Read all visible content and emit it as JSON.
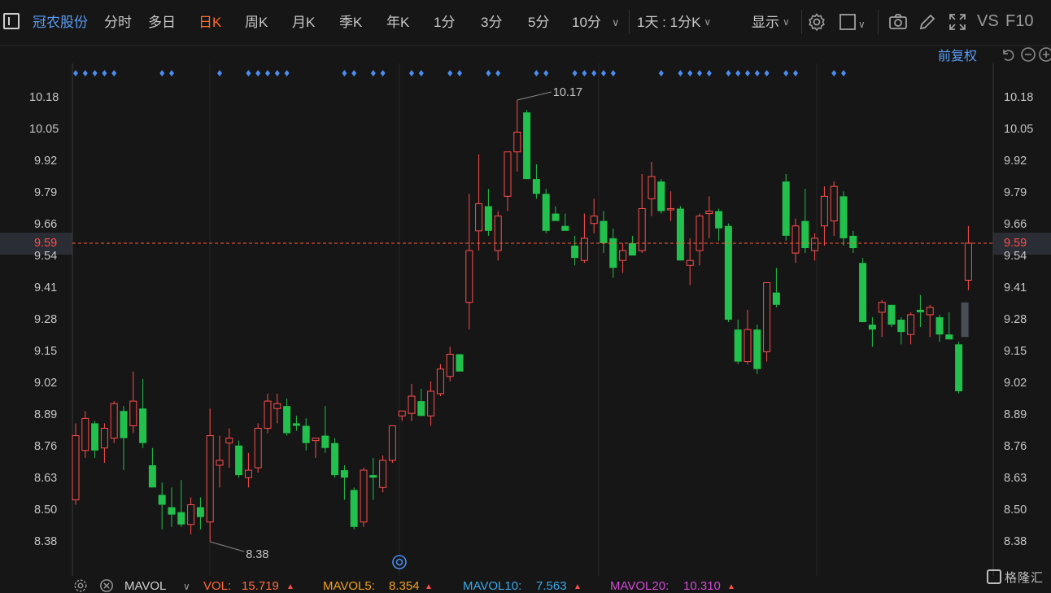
{
  "toolbar": {
    "stock_name": "冠农股份",
    "periods": [
      {
        "label": "分时",
        "active": false
      },
      {
        "label": "多日",
        "active": false
      },
      {
        "label": "日K",
        "active": true
      },
      {
        "label": "周K",
        "active": false
      },
      {
        "label": "月K",
        "active": false
      },
      {
        "label": "季K",
        "active": false
      },
      {
        "label": "年K",
        "active": false
      },
      {
        "label": "1分",
        "active": false
      },
      {
        "label": "3分",
        "active": false
      },
      {
        "label": "5分",
        "active": false
      },
      {
        "label": "10分",
        "active": false
      }
    ],
    "interval_select": "1天 : 1分K",
    "display_label": "显示",
    "vs_label": "VS",
    "f10_label": "F10"
  },
  "chart": {
    "adjust_label": "前复权",
    "y_ticks": [
      "10.18",
      "10.05",
      "9.92",
      "9.79",
      "9.66",
      "9.54",
      "9.41",
      "9.28",
      "9.15",
      "9.02",
      "8.89",
      "8.76",
      "8.63",
      "8.50",
      "8.38"
    ],
    "current_price": "9.59",
    "max_label": "10.17",
    "min_label": "8.38",
    "colors": {
      "up": "#ff4d4d",
      "down": "#22c04c",
      "axis": "#3a3a3a",
      "marker": "#4a8df0"
    }
  },
  "chart_data": {
    "type": "candlestick",
    "ylim": [
      8.32,
      10.24
    ],
    "candles": [
      {
        "o": 8.55,
        "h": 8.86,
        "l": 8.53,
        "c": 8.81
      },
      {
        "o": 8.75,
        "h": 8.91,
        "l": 8.72,
        "c": 8.88
      },
      {
        "o": 8.86,
        "h": 8.87,
        "l": 8.72,
        "c": 8.75
      },
      {
        "o": 8.76,
        "h": 8.86,
        "l": 8.7,
        "c": 8.84
      },
      {
        "o": 8.8,
        "h": 8.95,
        "l": 8.78,
        "c": 8.94
      },
      {
        "o": 8.91,
        "h": 8.93,
        "l": 8.67,
        "c": 8.8
      },
      {
        "o": 8.85,
        "h": 9.07,
        "l": 8.82,
        "c": 8.95
      },
      {
        "o": 8.92,
        "h": 9.04,
        "l": 8.76,
        "c": 8.78
      },
      {
        "o": 8.69,
        "h": 8.76,
        "l": 8.61,
        "c": 8.6
      },
      {
        "o": 8.57,
        "h": 8.62,
        "l": 8.43,
        "c": 8.53
      },
      {
        "o": 8.52,
        "h": 8.6,
        "l": 8.44,
        "c": 8.49
      },
      {
        "o": 8.5,
        "h": 8.63,
        "l": 8.44,
        "c": 8.45
      },
      {
        "o": 8.45,
        "h": 8.56,
        "l": 8.41,
        "c": 8.53
      },
      {
        "o": 8.52,
        "h": 8.56,
        "l": 8.43,
        "c": 8.48
      },
      {
        "o": 8.46,
        "h": 8.92,
        "l": 8.38,
        "c": 8.81
      },
      {
        "o": 8.69,
        "h": 8.81,
        "l": 8.6,
        "c": 8.71
      },
      {
        "o": 8.78,
        "h": 8.84,
        "l": 8.68,
        "c": 8.8
      },
      {
        "o": 8.77,
        "h": 8.79,
        "l": 8.64,
        "c": 8.65
      },
      {
        "o": 8.64,
        "h": 8.74,
        "l": 8.6,
        "c": 8.67
      },
      {
        "o": 8.68,
        "h": 8.86,
        "l": 8.66,
        "c": 8.84
      },
      {
        "o": 8.84,
        "h": 8.98,
        "l": 8.82,
        "c": 8.95
      },
      {
        "o": 8.92,
        "h": 8.98,
        "l": 8.86,
        "c": 8.94
      },
      {
        "o": 8.93,
        "h": 8.96,
        "l": 8.81,
        "c": 8.82
      },
      {
        "o": 8.86,
        "h": 8.89,
        "l": 8.83,
        "c": 8.85
      },
      {
        "o": 8.85,
        "h": 8.88,
        "l": 8.75,
        "c": 8.78
      },
      {
        "o": 8.79,
        "h": 8.8,
        "l": 8.72,
        "c": 8.8
      },
      {
        "o": 8.81,
        "h": 8.93,
        "l": 8.74,
        "c": 8.76
      },
      {
        "o": 8.78,
        "h": 8.8,
        "l": 8.64,
        "c": 8.65
      },
      {
        "o": 8.67,
        "h": 8.69,
        "l": 8.55,
        "c": 8.64
      },
      {
        "o": 8.59,
        "h": 8.6,
        "l": 8.43,
        "c": 8.44
      },
      {
        "o": 8.46,
        "h": 8.68,
        "l": 8.44,
        "c": 8.67
      },
      {
        "o": 8.65,
        "h": 8.72,
        "l": 8.55,
        "c": 8.64
      },
      {
        "o": 8.6,
        "h": 8.73,
        "l": 8.58,
        "c": 8.71
      },
      {
        "o": 8.71,
        "h": 8.85,
        "l": 8.7,
        "c": 8.85
      },
      {
        "o": 8.89,
        "h": 8.91,
        "l": 8.87,
        "c": 8.91
      },
      {
        "o": 8.9,
        "h": 9.02,
        "l": 8.87,
        "c": 8.97
      },
      {
        "o": 8.95,
        "h": 9.0,
        "l": 8.89,
        "c": 8.89
      },
      {
        "o": 8.89,
        "h": 9.03,
        "l": 8.85,
        "c": 8.99
      },
      {
        "o": 8.98,
        "h": 9.1,
        "l": 8.97,
        "c": 9.08
      },
      {
        "o": 9.05,
        "h": 9.17,
        "l": 9.03,
        "c": 9.14
      },
      {
        "o": 9.14,
        "h": 9.14,
        "l": 9.08,
        "c": 9.07
      },
      {
        "o": 9.35,
        "h": 9.79,
        "l": 9.24,
        "c": 9.56
      },
      {
        "o": 9.64,
        "h": 9.95,
        "l": 9.56,
        "c": 9.75
      },
      {
        "o": 9.74,
        "h": 9.81,
        "l": 9.62,
        "c": 9.64
      },
      {
        "o": 9.56,
        "h": 9.72,
        "l": 9.52,
        "c": 9.7
      },
      {
        "o": 9.78,
        "h": 9.95,
        "l": 9.72,
        "c": 9.96
      },
      {
        "o": 9.96,
        "h": 10.17,
        "l": 9.88,
        "c": 10.04
      },
      {
        "o": 10.12,
        "h": 10.13,
        "l": 9.91,
        "c": 9.85
      },
      {
        "o": 9.85,
        "h": 9.91,
        "l": 9.77,
        "c": 9.79
      },
      {
        "o": 9.79,
        "h": 9.81,
        "l": 9.63,
        "c": 9.64
      },
      {
        "o": 9.71,
        "h": 9.74,
        "l": 9.69,
        "c": 9.68
      },
      {
        "o": 9.66,
        "h": 9.71,
        "l": 9.64,
        "c": 9.64
      },
      {
        "o": 9.58,
        "h": 9.62,
        "l": 9.5,
        "c": 9.53
      },
      {
        "o": 9.52,
        "h": 9.71,
        "l": 9.51,
        "c": 9.61
      },
      {
        "o": 9.67,
        "h": 9.77,
        "l": 9.63,
        "c": 9.7
      },
      {
        "o": 9.68,
        "h": 9.72,
        "l": 9.55,
        "c": 9.59
      },
      {
        "o": 9.61,
        "h": 9.65,
        "l": 9.45,
        "c": 9.49
      },
      {
        "o": 9.52,
        "h": 9.59,
        "l": 9.47,
        "c": 9.56
      },
      {
        "o": 9.59,
        "h": 9.62,
        "l": 9.56,
        "c": 9.54
      },
      {
        "o": 9.56,
        "h": 9.87,
        "l": 9.55,
        "c": 9.73
      },
      {
        "o": 9.77,
        "h": 9.92,
        "l": 9.7,
        "c": 9.86
      },
      {
        "o": 9.84,
        "h": 9.85,
        "l": 9.71,
        "c": 9.72
      },
      {
        "o": 9.73,
        "h": 9.8,
        "l": 9.68,
        "c": 9.73
      },
      {
        "o": 9.73,
        "h": 9.74,
        "l": 9.52,
        "c": 9.52
      },
      {
        "o": 9.5,
        "h": 9.61,
        "l": 9.42,
        "c": 9.52
      },
      {
        "o": 9.56,
        "h": 9.71,
        "l": 9.5,
        "c": 9.7
      },
      {
        "o": 9.71,
        "h": 9.78,
        "l": 9.61,
        "c": 9.72
      },
      {
        "o": 9.72,
        "h": 9.73,
        "l": 9.6,
        "c": 9.65
      },
      {
        "o": 9.66,
        "h": 9.67,
        "l": 9.27,
        "c": 9.28
      },
      {
        "o": 9.24,
        "h": 9.28,
        "l": 9.1,
        "c": 9.11
      },
      {
        "o": 9.11,
        "h": 9.32,
        "l": 9.1,
        "c": 9.24
      },
      {
        "o": 9.24,
        "h": 9.26,
        "l": 9.06,
        "c": 9.08
      },
      {
        "o": 9.15,
        "h": 9.41,
        "l": 9.11,
        "c": 9.43
      },
      {
        "o": 9.39,
        "h": 9.49,
        "l": 9.33,
        "c": 9.34
      },
      {
        "o": 9.84,
        "h": 9.87,
        "l": 9.6,
        "c": 9.62
      },
      {
        "o": 9.55,
        "h": 9.69,
        "l": 9.51,
        "c": 9.66
      },
      {
        "o": 9.68,
        "h": 9.81,
        "l": 9.55,
        "c": 9.57
      },
      {
        "o": 9.56,
        "h": 9.63,
        "l": 9.52,
        "c": 9.61
      },
      {
        "o": 9.66,
        "h": 9.82,
        "l": 9.58,
        "c": 9.78
      },
      {
        "o": 9.68,
        "h": 9.84,
        "l": 9.62,
        "c": 9.82
      },
      {
        "o": 9.78,
        "h": 9.8,
        "l": 9.58,
        "c": 9.61
      },
      {
        "o": 9.62,
        "h": 9.64,
        "l": 9.55,
        "c": 9.57
      },
      {
        "o": 9.51,
        "h": 9.53,
        "l": 9.27,
        "c": 9.27
      },
      {
        "o": 9.26,
        "h": 9.29,
        "l": 9.17,
        "c": 9.24
      },
      {
        "o": 9.31,
        "h": 9.36,
        "l": 9.21,
        "c": 9.35
      },
      {
        "o": 9.34,
        "h": 9.34,
        "l": 9.25,
        "c": 9.26
      },
      {
        "o": 9.28,
        "h": 9.29,
        "l": 9.18,
        "c": 9.23
      },
      {
        "o": 9.22,
        "h": 9.31,
        "l": 9.18,
        "c": 9.3
      },
      {
        "o": 9.32,
        "h": 9.38,
        "l": 9.25,
        "c": 9.31
      },
      {
        "o": 9.3,
        "h": 9.34,
        "l": 9.21,
        "c": 9.33
      },
      {
        "o": 9.29,
        "h": 9.3,
        "l": 9.19,
        "c": 9.22
      },
      {
        "o": 9.22,
        "h": 9.31,
        "l": 9.21,
        "c": 9.2
      },
      {
        "o": 9.18,
        "h": 9.19,
        "l": 8.98,
        "c": 8.99
      },
      {
        "o": 9.44,
        "h": 9.66,
        "l": 9.4,
        "c": 9.59
      }
    ],
    "markers": [
      0,
      1,
      2,
      3,
      4,
      9,
      10,
      15,
      18,
      19,
      20,
      21,
      22,
      28,
      29,
      31,
      32,
      35,
      36,
      39,
      40,
      43,
      44,
      48,
      49,
      52,
      53,
      54,
      55,
      56,
      61,
      63,
      64,
      65,
      66,
      68,
      69,
      70,
      71,
      72,
      74,
      75,
      79,
      80
    ]
  },
  "bottom": {
    "indicator": "MAVOL",
    "vol_label": "VOL:",
    "vol_value": "15.719",
    "mavol5_label": "MAVOL5:",
    "mavol5_value": "8.354",
    "mavol10_label": "MAVOL10:",
    "mavol10_value": "7.563",
    "mavol20_label": "MAVOL20:",
    "mavol20_value": "10.310",
    "logo": "格隆汇"
  }
}
